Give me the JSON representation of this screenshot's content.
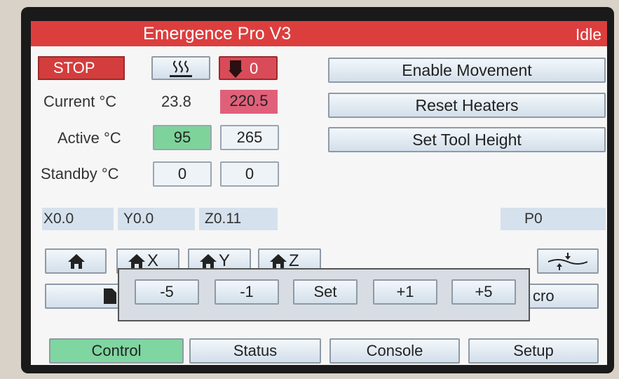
{
  "header": {
    "title": "Emergence Pro V3",
    "status": "Idle"
  },
  "controls": {
    "stop_label": "STOP",
    "tool_heater_value": "0"
  },
  "temperatures": {
    "current_label": "Current °C",
    "active_label": "Active °C",
    "standby_label": "Standby °C",
    "bed": {
      "current": "23.8",
      "active": "95",
      "standby": "0"
    },
    "tool": {
      "current": "220.5",
      "active": "265",
      "standby": "0"
    }
  },
  "actions": {
    "enable_movement": "Enable Movement",
    "reset_heaters": "Reset Heaters",
    "set_tool_height": "Set Tool Height"
  },
  "axes": {
    "x": "X0.0",
    "y": "Y0.0",
    "z": "Z0.11",
    "p": "P0"
  },
  "home": {
    "x": "X",
    "y": "Y",
    "z": "Z"
  },
  "jog": {
    "minus5": "-5",
    "minus1": "-1",
    "set": "Set",
    "plus1": "+1",
    "plus5": "+5"
  },
  "partial": {
    "macro_right": "cro"
  },
  "tabs": {
    "control": "Control",
    "status": "Status",
    "console": "Console",
    "setup": "Setup"
  },
  "colors": {
    "header": "#dc3e3e",
    "stop": "#d33d3d",
    "tool_hot": "#d94b58",
    "bed_active": "#7ed39a",
    "control_tab": "#7fd6a1"
  },
  "icons": {
    "bed_heater": "heat-waves-icon",
    "tool_heater": "extruder-icon",
    "home": "house-icon",
    "bed_level": "bed-level-icon",
    "macro": "file-icon"
  }
}
